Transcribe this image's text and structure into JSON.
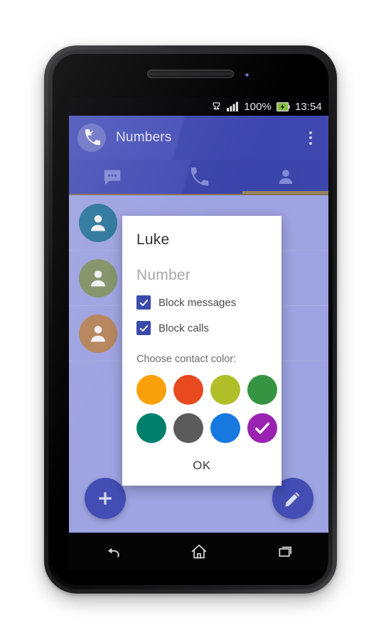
{
  "status_bar": {
    "icons": [
      "trophy-icon",
      "signal-icon",
      "battery-icon"
    ],
    "battery_percent": "100%",
    "time": "13:54"
  },
  "app_bar": {
    "icon": "missed-call-icon",
    "title": "Numbers",
    "overflow_icon": "overflow-menu-icon"
  },
  "tabs": [
    {
      "name": "messages",
      "icon": "message-bubble-icon",
      "active": false
    },
    {
      "name": "calls",
      "icon": "phone-icon",
      "active": false
    },
    {
      "name": "contacts",
      "icon": "person-icon",
      "active": true
    }
  ],
  "tab_indicator_color": "#9d8b62",
  "contacts": [
    {
      "name": "contact-1",
      "avatar_color": "#2e7ca3"
    },
    {
      "name": "contact-2",
      "avatar_color": "#8a9a6b"
    },
    {
      "name": "contact-3",
      "avatar_color": "#c08c5e"
    }
  ],
  "fabs": [
    {
      "name": "add",
      "icon": "plus-icon",
      "color": "#4650bb"
    },
    {
      "name": "edit",
      "icon": "pencil-icon",
      "color": "#4650bb"
    }
  ],
  "dialog": {
    "name_value": "Luke",
    "number_placeholder": "Number",
    "checkboxes": [
      {
        "label": "Block messages",
        "checked": true
      },
      {
        "label": "Block calls",
        "checked": true
      }
    ],
    "color_section_label": "Choose contact color:",
    "colors": [
      {
        "name": "orange",
        "hex": "#f9a00b",
        "selected": false
      },
      {
        "name": "red-orange",
        "hex": "#e8491f",
        "selected": false
      },
      {
        "name": "yellow-green",
        "hex": "#b0bf28",
        "selected": false
      },
      {
        "name": "green",
        "hex": "#359441",
        "selected": false
      },
      {
        "name": "teal",
        "hex": "#00806c",
        "selected": false
      },
      {
        "name": "gray",
        "hex": "#5b5b5b",
        "selected": false
      },
      {
        "name": "blue",
        "hex": "#1779df",
        "selected": false
      },
      {
        "name": "purple",
        "hex": "#9a22b2",
        "selected": true
      }
    ],
    "ok_label": "OK",
    "checkbox_color": "#3949ab"
  },
  "nav_bar": {
    "buttons": [
      {
        "name": "back",
        "icon": "back-arrow-icon"
      },
      {
        "name": "home",
        "icon": "home-icon"
      },
      {
        "name": "recents",
        "icon": "recent-apps-icon"
      }
    ]
  }
}
